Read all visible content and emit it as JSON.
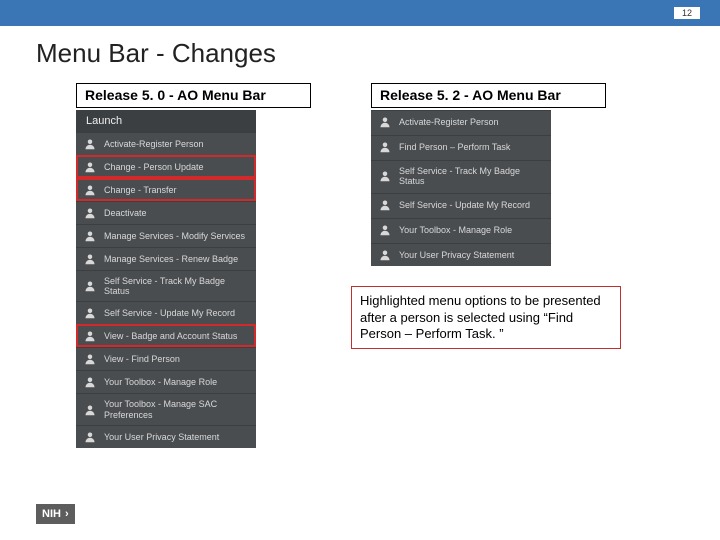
{
  "page_number": "12",
  "title": "Menu Bar - Changes",
  "left": {
    "heading": "Release 5. 0 - AO Menu Bar",
    "launch": "Launch",
    "items": [
      "Activate-Register Person",
      "Change - Person Update",
      "Change - Transfer",
      "Deactivate",
      "Manage Services - Modify Services",
      "Manage Services - Renew Badge",
      "Self Service - Track My Badge Status",
      "Self Service - Update My Record",
      "View - Badge and Account Status",
      "View - Find Person",
      "Your Toolbox - Manage Role",
      "Your Toolbox - Manage SAC Preferences",
      "Your User Privacy Statement"
    ],
    "highlight_indices": [
      1,
      2,
      8
    ]
  },
  "right": {
    "heading": "Release 5. 2 - AO Menu Bar",
    "items": [
      "Activate-Register Person",
      "Find Person – Perform Task",
      "Self Service - Track My Badge Status",
      "Self Service - Update My Record",
      "Your Toolbox - Manage Role",
      "Your User Privacy Statement"
    ]
  },
  "note": "Highlighted menu options to be presented after a person is selected using “Find Person – Perform Task. ”",
  "nih_label": "NIH"
}
